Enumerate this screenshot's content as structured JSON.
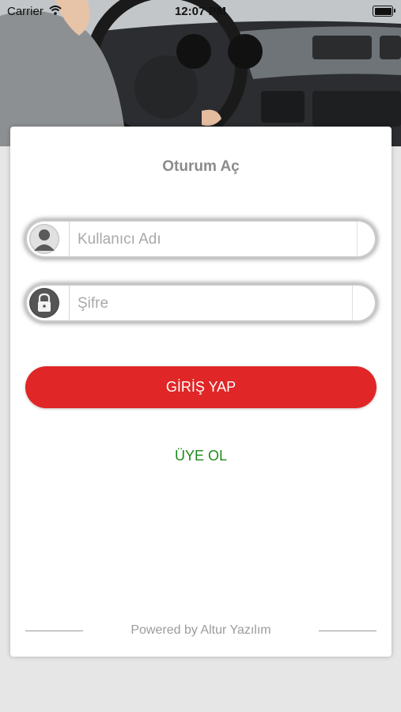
{
  "status_bar": {
    "carrier": "Carrier",
    "time": "12:07 PM"
  },
  "login": {
    "title": "Oturum Aç",
    "username_placeholder": "Kullanıcı Adı",
    "password_placeholder": "Şifre",
    "login_button": "GİRİŞ YAP",
    "signup_link": "ÜYE OL",
    "footer": "Powered by Altur Yazılım"
  },
  "colors": {
    "accent_red": "#e02626",
    "signup_green": "#1e8a1e"
  },
  "icons": {
    "username": "user-icon",
    "password": "lock-icon"
  }
}
